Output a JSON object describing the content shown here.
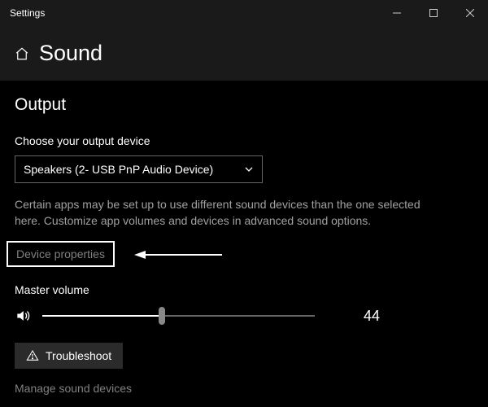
{
  "window": {
    "title": "Settings"
  },
  "header": {
    "page_title": "Sound"
  },
  "output": {
    "section_heading": "Output",
    "choose_label": "Choose your output device",
    "selected_device": "Speakers (2- USB PnP Audio Device)",
    "description": "Certain apps may be set up to use different sound devices than the one selected here. Customize app volumes and devices in advanced sound options.",
    "device_properties_link": "Device properties",
    "master_volume_label": "Master volume",
    "master_volume_value": "44",
    "troubleshoot_label": "Troubleshoot",
    "manage_devices_link": "Manage sound devices"
  }
}
